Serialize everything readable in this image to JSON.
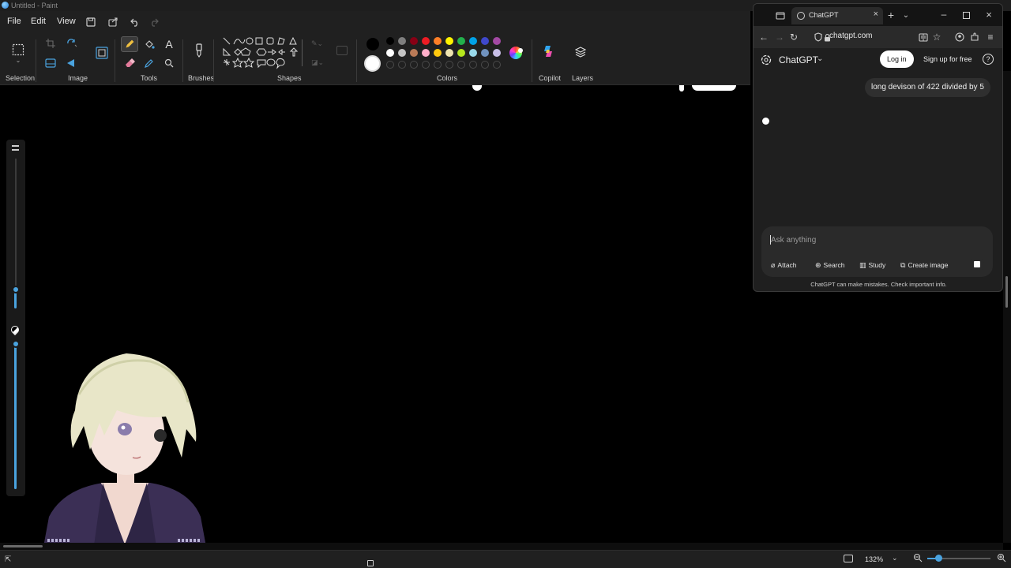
{
  "paint": {
    "title": "Untitled - Paint",
    "menu": {
      "file": "File",
      "edit": "Edit",
      "view": "View"
    },
    "groups": {
      "selection": "Selection",
      "image": "Image",
      "tools": "Tools",
      "brushes": "Brushes",
      "shapes": "Shapes",
      "colors": "Colors",
      "copilot": "Copilot",
      "layers": "Layers"
    },
    "palette_row1": [
      "#000000",
      "#7f7f7f",
      "#880015",
      "#ed1c24",
      "#ff7f27",
      "#fff200",
      "#22b14c",
      "#00a2e8",
      "#3f48cc",
      "#a349a4"
    ],
    "palette_row2": [
      "#ffffff",
      "#c3c3c3",
      "#b97a57",
      "#ffaec9",
      "#ffc90e",
      "#efe4b0",
      "#b5e61d",
      "#99d9ea",
      "#7092be",
      "#c8bfe7"
    ],
    "primary_color": "#000000",
    "secondary_color": "#ffffff",
    "zoom": "132%"
  },
  "browser": {
    "tab_title": "ChatGPT",
    "url": "chatgpt.com",
    "brand": "ChatGPT",
    "login": "Log in",
    "signup": "Sign up for free",
    "help": "?",
    "user_message": "long devison of 422 divided by 5",
    "input_placeholder": "Ask anything",
    "actions": {
      "attach": "Attach",
      "search": "Search",
      "study": "Study",
      "create_image": "Create image"
    },
    "disclaimer": "ChatGPT can make mistakes. Check important info."
  }
}
